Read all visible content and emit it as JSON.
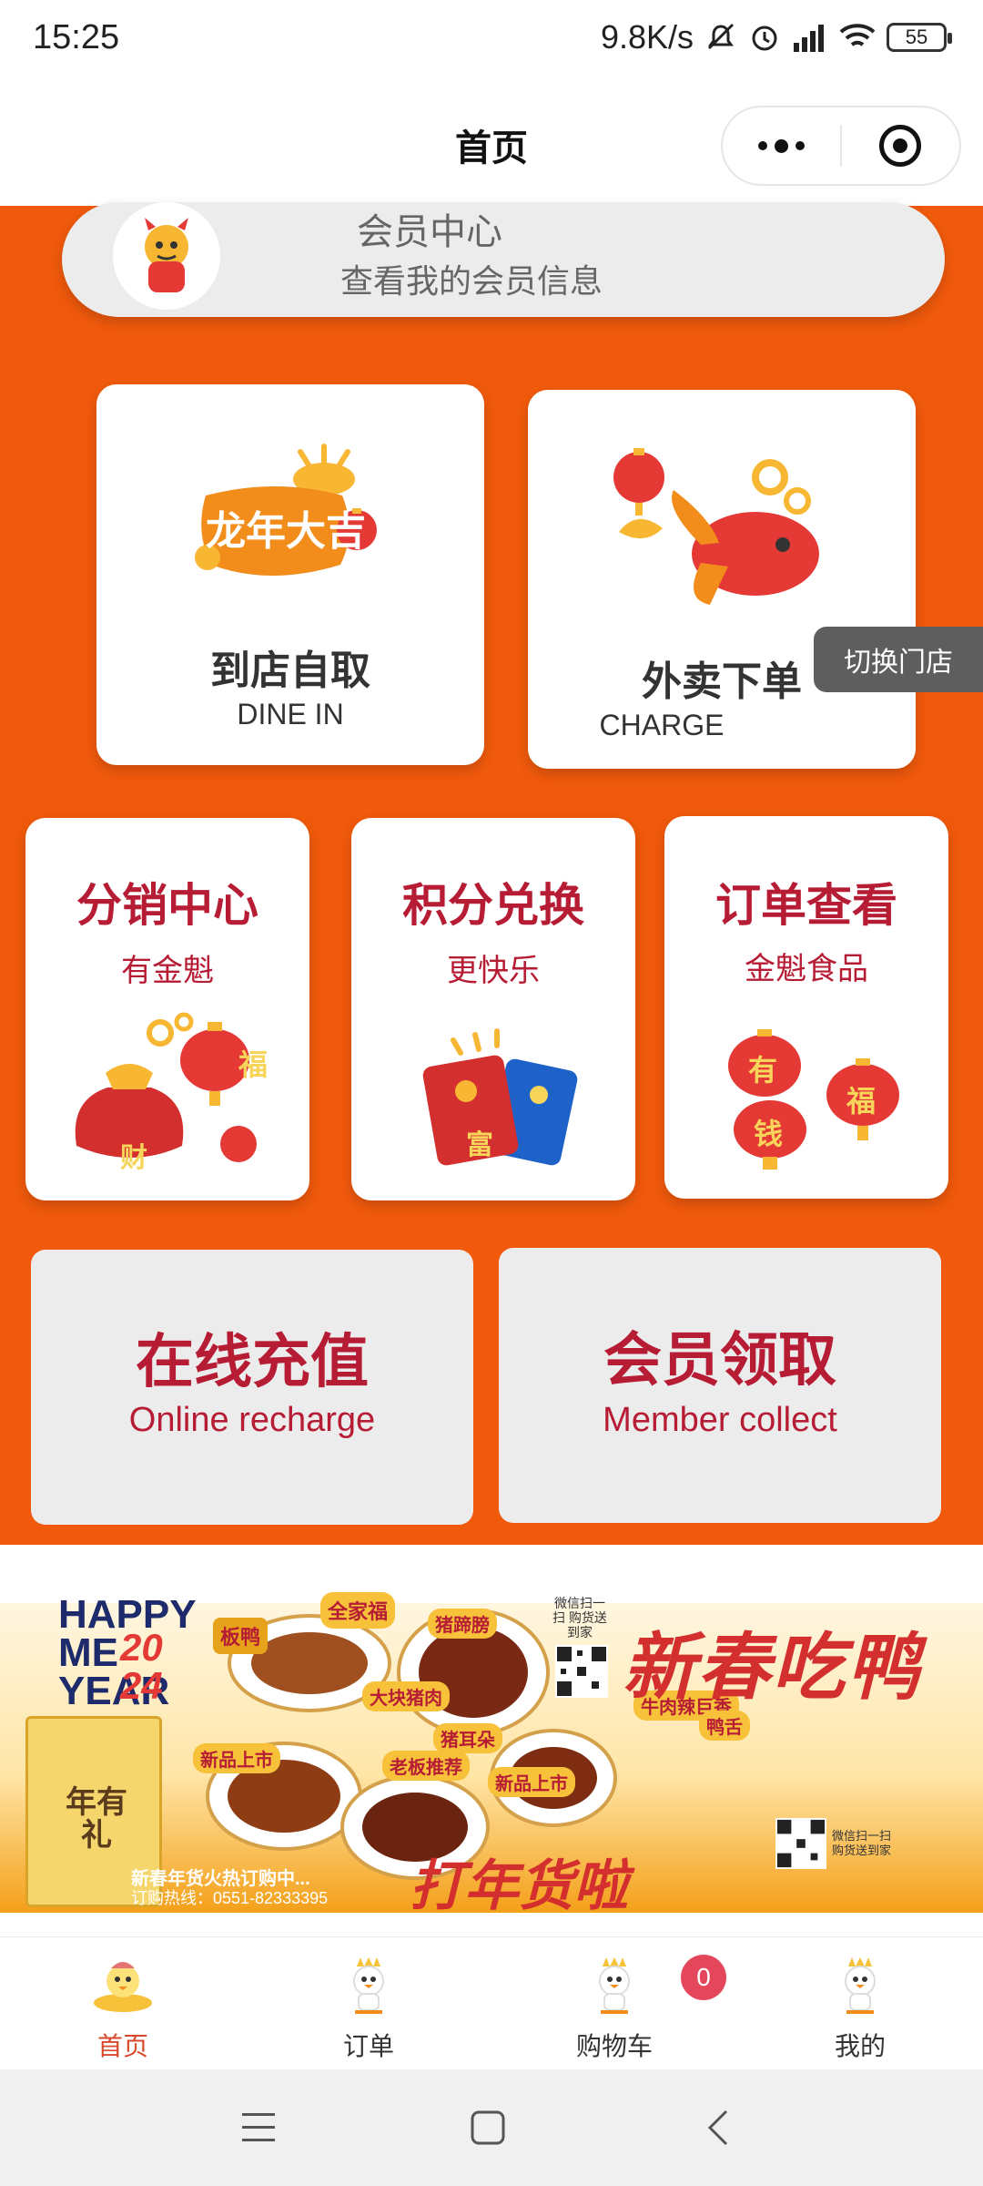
{
  "status_bar": {
    "time": "15:25",
    "network_speed": "9.8K/s",
    "battery": "55"
  },
  "nav": {
    "title": "首页"
  },
  "member_center": {
    "title": "会员中心",
    "subtitle": "查看我的会员信息"
  },
  "big_cards": [
    {
      "title": "到店自取",
      "subtitle": "DINE IN",
      "badge": "龙年大吉"
    },
    {
      "title": "外卖下单",
      "subtitle": "CHARGE"
    }
  ],
  "switch_store": "切换门店",
  "mid_cards": [
    {
      "title": "分销中心",
      "subtitle": "有金魁",
      "icon_text": [
        "福",
        "财"
      ]
    },
    {
      "title": "积分兑换",
      "subtitle": "更快乐",
      "icon_text": [
        "富"
      ]
    },
    {
      "title": "订单查看",
      "subtitle": "金魁食品",
      "icon_text": [
        "有",
        "钱",
        "福"
      ]
    }
  ],
  "gray_cards": [
    {
      "title": "在线充值",
      "subtitle": "Online recharge"
    },
    {
      "title": "会员领取",
      "subtitle": "Member collect"
    }
  ],
  "banner": {
    "happy": "HAPPY",
    "me": "ME",
    "year": "YEAR",
    "year_num_top": "20",
    "year_num_bottom": "24",
    "headline": "新春吃鸭",
    "bottom_headline": "打年货啦",
    "tags": [
      "板鸭",
      "全家福",
      "猪蹄膀",
      "大块猪肉",
      "猪耳朵",
      "老板推荐",
      "新品上市",
      "新品上市",
      "牛肉辣巨香",
      "鸭舌"
    ],
    "qr_label_top": "微信扫一扫 购货送到家",
    "qr_label_bottom": "微信扫一扫 购货送到家",
    "hotline_1": "新春年货火热订购中...",
    "hotline_2": "订购热线：0551-82333395",
    "gift_box": "年有礼"
  },
  "tabs": [
    {
      "label": "首页",
      "active": true
    },
    {
      "label": "订单",
      "active": false
    },
    {
      "label": "购物车",
      "active": false
    },
    {
      "label": "我的",
      "active": false
    }
  ],
  "cart_count": "0",
  "colors": {
    "primary_orange": "#f15a0c",
    "brand_red": "#b71c35",
    "active_tab": "#d8492b"
  }
}
